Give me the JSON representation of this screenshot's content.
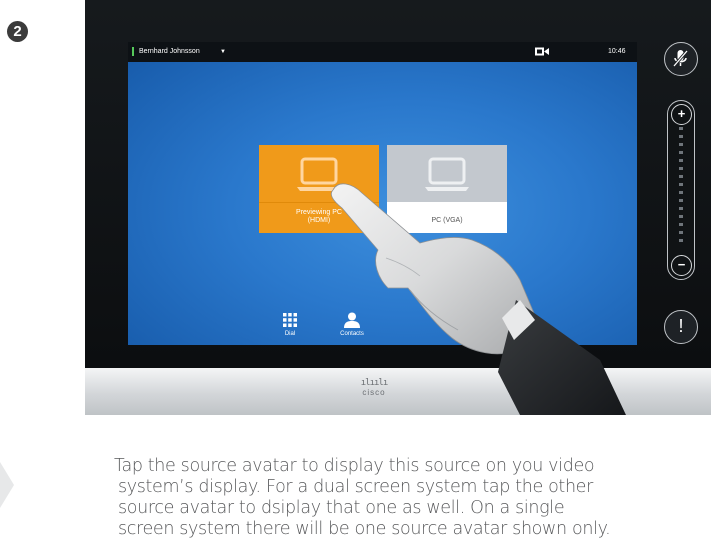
{
  "step": {
    "number": "2"
  },
  "device": {
    "brand": "cisco",
    "brand_bars": "ılıılı",
    "status_bar": {
      "user_name": "Bernhard Johnsson",
      "caret": "▼",
      "time": "10:46",
      "presence_color": "#56c95a",
      "camera_icon": "camera-icon"
    },
    "sources": [
      {
        "caption_line1": "Previewing PC",
        "caption_line2": "(HDMI)",
        "color": "#f09a1a",
        "icon": "laptop-icon"
      },
      {
        "caption_line1": "PC (VGA)",
        "caption_line2": "",
        "color": "#c3c8ce",
        "icon": "laptop-icon"
      }
    ],
    "dock": [
      {
        "label": "Dial",
        "icon": "keypad-icon"
      },
      {
        "label": "Contacts",
        "icon": "person-icon"
      }
    ],
    "side_controls": {
      "mute_icon": "microphone-muted-icon",
      "volume_plus": "+",
      "volume_minus": "−",
      "alert_symbol": "!"
    }
  },
  "instructions": {
    "lines": [
      "Tap the source avatar to display this source on you video",
      "system’s display. For a dual screen system tap the other",
      "source avatar to dsiplay that one as well. On a single",
      "screen system there will be one source avatar shown only."
    ]
  },
  "colors": {
    "text": "#58595b",
    "screen_blue": "#2a78cc",
    "accent_orange": "#f09a1a"
  }
}
